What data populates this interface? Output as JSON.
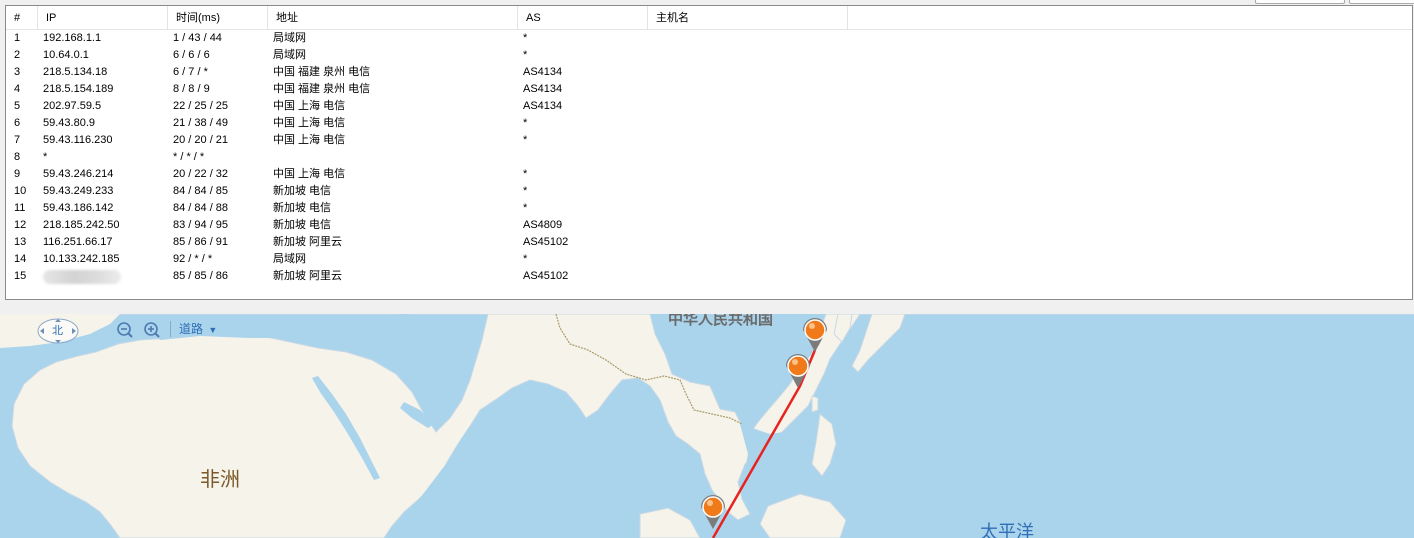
{
  "table": {
    "headers": [
      "#",
      "IP",
      "时间(ms)",
      "地址",
      "AS",
      "主机名"
    ],
    "rows": [
      {
        "n": "1",
        "ip": "192.168.1.1",
        "time": "1 / 43 / 44",
        "addr": "局域网",
        "as": "*"
      },
      {
        "n": "2",
        "ip": "10.64.0.1",
        "time": "6 / 6 / 6",
        "addr": "局域网",
        "as": "*"
      },
      {
        "n": "3",
        "ip": "218.5.134.18",
        "time": "6 / 7 / *",
        "addr": "中国 福建 泉州 电信",
        "as": "AS4134"
      },
      {
        "n": "4",
        "ip": "218.5.154.189",
        "time": "8 / 8 / 9",
        "addr": "中国 福建 泉州 电信",
        "as": "AS4134"
      },
      {
        "n": "5",
        "ip": "202.97.59.5",
        "time": "22 / 25 / 25",
        "addr": "中国 上海 电信",
        "as": "AS4134"
      },
      {
        "n": "6",
        "ip": "59.43.80.9",
        "time": "21 / 38 / 49",
        "addr": "中国 上海 电信",
        "as": "*"
      },
      {
        "n": "7",
        "ip": "59.43.116.230",
        "time": "20 / 20 / 21",
        "addr": "中国 上海 电信",
        "as": "*"
      },
      {
        "n": "8",
        "ip": "*",
        "time": "* / * / *",
        "addr": "",
        "as": ""
      },
      {
        "n": "9",
        "ip": "59.43.246.214",
        "time": "20 / 22 / 32",
        "addr": "中国 上海 电信",
        "as": "*"
      },
      {
        "n": "10",
        "ip": "59.43.249.233",
        "time": "84 / 84 / 85",
        "addr": "新加坡 电信",
        "as": "*"
      },
      {
        "n": "11",
        "ip": "59.43.186.142",
        "time": "84 / 84 / 88",
        "addr": "新加坡 电信",
        "as": "*"
      },
      {
        "n": "12",
        "ip": "218.185.242.50",
        "time": "83 / 94 / 95",
        "addr": "新加坡 电信",
        "as": "AS4809"
      },
      {
        "n": "13",
        "ip": "116.251.66.17",
        "time": "85 / 86 / 91",
        "addr": "新加坡 阿里云",
        "as": "AS45102"
      },
      {
        "n": "14",
        "ip": "10.133.242.185",
        "time": "92 / * / *",
        "addr": "局域网",
        "as": "*"
      },
      {
        "n": "15",
        "ip": "",
        "time": "85 / 85 / 86",
        "addr": "新加坡 阿里云",
        "as": "AS45102"
      }
    ]
  },
  "map": {
    "compass_label": "北",
    "zoom_out_icon": "zoom-out-icon",
    "zoom_in_icon": "zoom-in-icon",
    "map_type_label": "道路",
    "labels": {
      "china": "中华人民共和国",
      "africa": "非洲",
      "pacific": "太平洋"
    },
    "colors": {
      "water": "#aad3ec",
      "land": "#f6f3ea",
      "route": "#e8231f",
      "marker": "#f07a1a",
      "ui_blue": "#2f6fb5"
    }
  }
}
